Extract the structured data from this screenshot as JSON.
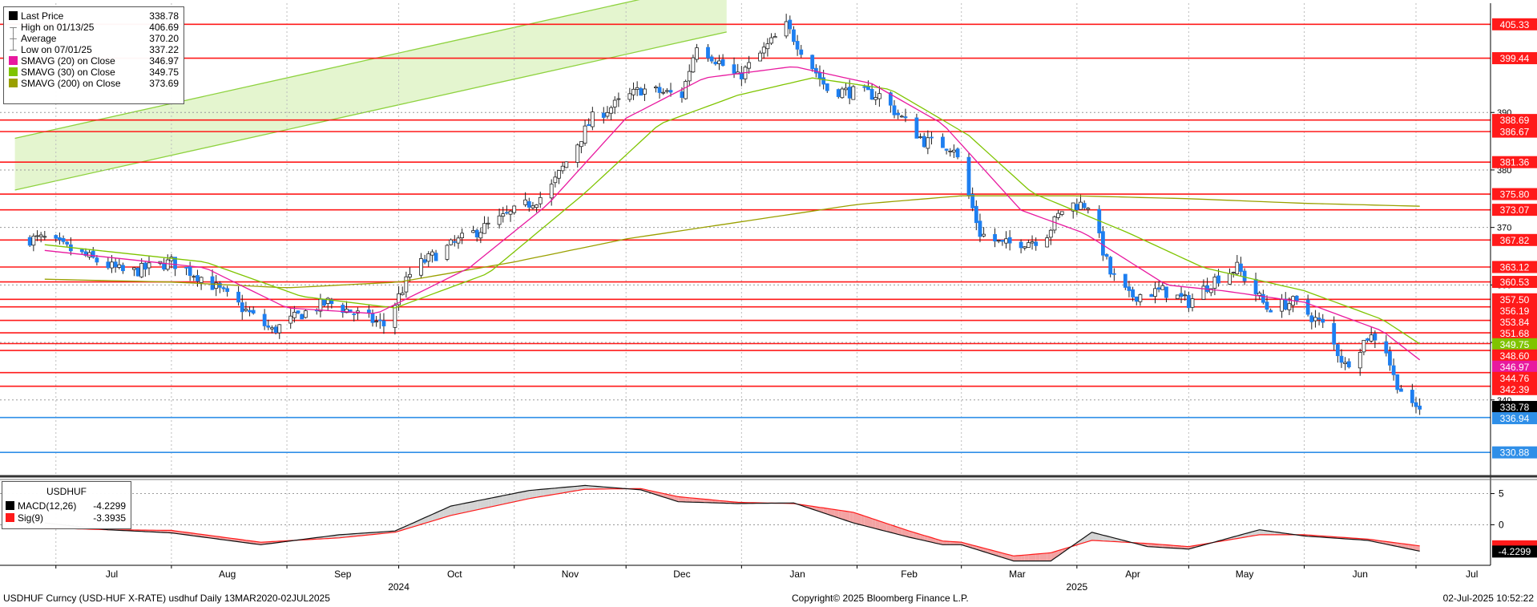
{
  "legend": {
    "items": [
      {
        "label": "Last Price",
        "value": "338.78",
        "color": "#000000",
        "kind": "box"
      },
      {
        "label": "High on 01/13/25",
        "value": "406.69",
        "kind": "tree"
      },
      {
        "label": "Average",
        "value": "370.20",
        "kind": "tree"
      },
      {
        "label": "Low on 07/01/25",
        "value": "337.22",
        "kind": "tree"
      },
      {
        "label": "SMAVG (20)  on Close",
        "value": "346.97",
        "color": "#e8199f",
        "kind": "box"
      },
      {
        "label": "SMAVG (30)  on Close",
        "value": "349.75",
        "color": "#7fc400",
        "kind": "box"
      },
      {
        "label": "SMAVG (200)  on Close",
        "value": "373.69",
        "color": "#9aa000",
        "kind": "box"
      }
    ]
  },
  "macd_legend": {
    "title": "USDHUF",
    "items": [
      {
        "label": "MACD(12,26)",
        "value": "-4.2299",
        "color": "#000000"
      },
      {
        "label": "Sig(9)",
        "value": "-3.3935",
        "color": "#ff1a1a"
      }
    ]
  },
  "footer": {
    "left": "USDHUF Curncy (USD-HUF X-RATE) usdhuf  Daily 13MAR2020-02JUL2025",
    "center": "Copyright© 2025 Bloomberg Finance L.P.",
    "right": "02-Jul-2025 10:52:22"
  },
  "chart_data": {
    "type": "candlestick",
    "title": "",
    "xlabel": "",
    "ylabel": "",
    "ylim": [
      327,
      409
    ],
    "grid": true,
    "legend_position": "top-left",
    "x_months": [
      "Jul",
      "Aug",
      "Sep",
      "Oct",
      "Nov",
      "Dec",
      "Jan",
      "Feb",
      "Mar",
      "Apr",
      "May",
      "Jun",
      "Jul"
    ],
    "x_years": [
      "2024",
      "2025"
    ],
    "y_ticks": [
      340,
      350,
      360,
      370,
      380,
      390
    ],
    "price_key": [
      {
        "x": "2024-06-28",
        "y": 368
      },
      {
        "x": "2024-07-20",
        "y": 362
      },
      {
        "x": "2024-08-01",
        "y": 364
      },
      {
        "x": "2024-08-10",
        "y": 361
      },
      {
        "x": "2024-08-28",
        "y": 352
      },
      {
        "x": "2024-09-05",
        "y": 355
      },
      {
        "x": "2024-09-12",
        "y": 357
      },
      {
        "x": "2024-09-27",
        "y": 353
      },
      {
        "x": "2024-10-05",
        "y": 363
      },
      {
        "x": "2024-10-18",
        "y": 368
      },
      {
        "x": "2024-10-30",
        "y": 372
      },
      {
        "x": "2024-11-10",
        "y": 376
      },
      {
        "x": "2024-11-22",
        "y": 389
      },
      {
        "x": "2024-12-05",
        "y": 394
      },
      {
        "x": "2024-12-16",
        "y": 393
      },
      {
        "x": "2024-12-20",
        "y": 402
      },
      {
        "x": "2024-12-31",
        "y": 396
      },
      {
        "x": "2025-01-13",
        "y": 405
      },
      {
        "x": "2025-01-24",
        "y": 394
      },
      {
        "x": "2025-02-07",
        "y": 393
      },
      {
        "x": "2025-02-19",
        "y": 385
      },
      {
        "x": "2025-02-27",
        "y": 384
      },
      {
        "x": "2025-03-06",
        "y": 369
      },
      {
        "x": "2025-03-12",
        "y": 367
      },
      {
        "x": "2025-03-23",
        "y": 368
      },
      {
        "x": "2025-03-29",
        "y": 374
      },
      {
        "x": "2025-04-04",
        "y": 374
      },
      {
        "x": "2025-04-10",
        "y": 362
      },
      {
        "x": "2025-04-15",
        "y": 358
      },
      {
        "x": "2025-04-24",
        "y": 359
      },
      {
        "x": "2025-05-01",
        "y": 357
      },
      {
        "x": "2025-05-08",
        "y": 361
      },
      {
        "x": "2025-05-14",
        "y": 363
      },
      {
        "x": "2025-05-22",
        "y": 356
      },
      {
        "x": "2025-05-29",
        "y": 357
      },
      {
        "x": "2025-06-06",
        "y": 353
      },
      {
        "x": "2025-06-12",
        "y": 346
      },
      {
        "x": "2025-06-18",
        "y": 351
      },
      {
        "x": "2025-06-22",
        "y": 351
      },
      {
        "x": "2025-06-25",
        "y": 344
      },
      {
        "x": "2025-06-30",
        "y": 338.5
      },
      {
        "x": "2025-07-02",
        "y": 338.78
      }
    ],
    "sma20": [
      {
        "x": "2024-06-28",
        "y": 366
      },
      {
        "x": "2024-08-10",
        "y": 363
      },
      {
        "x": "2024-09-01",
        "y": 356
      },
      {
        "x": "2024-09-25",
        "y": 355
      },
      {
        "x": "2024-10-20",
        "y": 363
      },
      {
        "x": "2024-11-10",
        "y": 374
      },
      {
        "x": "2024-12-01",
        "y": 389
      },
      {
        "x": "2024-12-22",
        "y": 396
      },
      {
        "x": "2025-01-15",
        "y": 398
      },
      {
        "x": "2025-02-05",
        "y": 395
      },
      {
        "x": "2025-02-24",
        "y": 388
      },
      {
        "x": "2025-03-17",
        "y": 373
      },
      {
        "x": "2025-04-03",
        "y": 369
      },
      {
        "x": "2025-04-25",
        "y": 360
      },
      {
        "x": "2025-05-10",
        "y": 359
      },
      {
        "x": "2025-06-01",
        "y": 357
      },
      {
        "x": "2025-06-22",
        "y": 352
      },
      {
        "x": "2025-07-02",
        "y": 346.97
      }
    ],
    "sma30": [
      {
        "x": "2024-06-28",
        "y": 367
      },
      {
        "x": "2024-08-10",
        "y": 364
      },
      {
        "x": "2024-09-05",
        "y": 358
      },
      {
        "x": "2024-09-30",
        "y": 356
      },
      {
        "x": "2024-10-25",
        "y": 362
      },
      {
        "x": "2024-11-20",
        "y": 376
      },
      {
        "x": "2024-12-10",
        "y": 388
      },
      {
        "x": "2024-12-31",
        "y": 393
      },
      {
        "x": "2025-01-20",
        "y": 396
      },
      {
        "x": "2025-02-10",
        "y": 394
      },
      {
        "x": "2025-03-03",
        "y": 386
      },
      {
        "x": "2025-03-20",
        "y": 376
      },
      {
        "x": "2025-04-15",
        "y": 369
      },
      {
        "x": "2025-05-05",
        "y": 363
      },
      {
        "x": "2025-06-01",
        "y": 359
      },
      {
        "x": "2025-06-22",
        "y": 354
      },
      {
        "x": "2025-07-02",
        "y": 349.75
      }
    ],
    "sma200": [
      {
        "x": "2024-06-28",
        "y": 361
      },
      {
        "x": "2024-08-01",
        "y": 360.5
      },
      {
        "x": "2024-09-01",
        "y": 359.5
      },
      {
        "x": "2024-10-01",
        "y": 360.5
      },
      {
        "x": "2024-11-01",
        "y": 364
      },
      {
        "x": "2024-12-01",
        "y": 368
      },
      {
        "x": "2025-01-01",
        "y": 371
      },
      {
        "x": "2025-02-01",
        "y": 374
      },
      {
        "x": "2025-03-01",
        "y": 375.5
      },
      {
        "x": "2025-04-01",
        "y": 375.5
      },
      {
        "x": "2025-05-01",
        "y": 375
      },
      {
        "x": "2025-06-01",
        "y": 374.2
      },
      {
        "x": "2025-07-02",
        "y": 373.69
      }
    ],
    "channel": {
      "lower": [
        {
          "x": "2024-06-20",
          "y": 376.5
        },
        {
          "x": "2024-12-28",
          "y": 404
        }
      ],
      "upper": [
        {
          "x": "2024-06-20",
          "y": 385.5
        },
        {
          "x": "2024-12-28",
          "y": 413
        }
      ]
    },
    "hlines_red": [
      405.33,
      399.44,
      388.69,
      386.67,
      381.36,
      375.8,
      373.07,
      367.82,
      363.12,
      360.53,
      357.5,
      356.19,
      353.84,
      351.68,
      349.8,
      348.6,
      344.76,
      342.39
    ],
    "hlines_blue": [
      336.94,
      330.88
    ],
    "right_labels": [
      {
        "value": "405.33",
        "color": "#ff1a1a",
        "text_color": "#ffffff"
      },
      {
        "value": "399.44",
        "color": "#ff1a1a",
        "text_color": "#ffffff"
      },
      {
        "value": "388.69",
        "color": "#ff1a1a",
        "text_color": "#ffffff"
      },
      {
        "value": "386.67",
        "color": "#ff1a1a",
        "text_color": "#ffffff"
      },
      {
        "value": "381.36",
        "color": "#ff1a1a",
        "text_color": "#ffffff"
      },
      {
        "value": "375.80",
        "color": "#ff1a1a",
        "text_color": "#ffffff"
      },
      {
        "value": "373.07",
        "color": "#ff1a1a",
        "text_color": "#ffffff"
      },
      {
        "value": "367.82",
        "color": "#ff1a1a",
        "text_color": "#ffffff"
      },
      {
        "value": "363.12",
        "color": "#ff1a1a",
        "text_color": "#ffffff"
      },
      {
        "value": "360.53",
        "color": "#ff1a1a",
        "text_color": "#ffffff"
      },
      {
        "value": "357.50",
        "color": "#ff1a1a",
        "text_color": "#ffffff"
      },
      {
        "value": "356.19",
        "color": "#ff1a1a",
        "text_color": "#ffffff"
      },
      {
        "value": "353.84",
        "color": "#ff1a1a",
        "text_color": "#ffffff"
      },
      {
        "value": "351.68",
        "color": "#ff1a1a",
        "text_color": "#ffffff"
      },
      {
        "value": "349.75",
        "color": "#7fc400",
        "text_color": "#ffffff"
      },
      {
        "value": "348.60",
        "color": "#ff1a1a",
        "text_color": "#ffffff"
      },
      {
        "value": "346.97",
        "color": "#e8199f",
        "text_color": "#ffffff"
      },
      {
        "value": "344.76",
        "color": "#ff1a1a",
        "text_color": "#ffffff"
      },
      {
        "value": "342.39",
        "color": "#ff1a1a",
        "text_color": "#ffffff"
      },
      {
        "value": "338.78",
        "color": "#000000",
        "text_color": "#ffffff"
      },
      {
        "value": "336.94",
        "color": "#2f8fe8",
        "text_color": "#ffffff"
      },
      {
        "value": "330.88",
        "color": "#2f8fe8",
        "text_color": "#ffffff"
      }
    ],
    "macd": {
      "ylim": [
        -6.5,
        7
      ],
      "y_ticks": [
        5,
        0
      ],
      "macd_key": [
        {
          "x": "2024-06-28",
          "y": 0.3
        },
        {
          "x": "2024-07-15",
          "y": -0.8
        },
        {
          "x": "2024-08-01",
          "y": -1.3
        },
        {
          "x": "2024-08-25",
          "y": -3.2
        },
        {
          "x": "2024-09-15",
          "y": -1.6
        },
        {
          "x": "2024-09-30",
          "y": -1.0
        },
        {
          "x": "2024-10-15",
          "y": 3.0
        },
        {
          "x": "2024-11-05",
          "y": 5.5
        },
        {
          "x": "2024-11-20",
          "y": 6.3
        },
        {
          "x": "2024-12-05",
          "y": 5.6
        },
        {
          "x": "2024-12-15",
          "y": 3.7
        },
        {
          "x": "2024-12-31",
          "y": 3.4
        },
        {
          "x": "2025-01-15",
          "y": 3.5
        },
        {
          "x": "2025-01-31",
          "y": 0.3
        },
        {
          "x": "2025-02-15",
          "y": -2.0
        },
        {
          "x": "2025-02-24",
          "y": -3.2
        },
        {
          "x": "2025-03-01",
          "y": -3.2
        },
        {
          "x": "2025-03-15",
          "y": -5.8
        },
        {
          "x": "2025-03-25",
          "y": -5.8
        },
        {
          "x": "2025-04-05",
          "y": -1.2
        },
        {
          "x": "2025-04-20",
          "y": -3.5
        },
        {
          "x": "2025-05-01",
          "y": -3.9
        },
        {
          "x": "2025-05-20",
          "y": -0.8
        },
        {
          "x": "2025-06-01",
          "y": -1.8
        },
        {
          "x": "2025-06-18",
          "y": -2.5
        },
        {
          "x": "2025-07-02",
          "y": -4.2299
        }
      ],
      "signal_key": [
        {
          "x": "2024-06-28",
          "y": -0.5
        },
        {
          "x": "2024-07-15",
          "y": -0.8
        },
        {
          "x": "2024-08-01",
          "y": -0.9
        },
        {
          "x": "2024-08-25",
          "y": -2.8
        },
        {
          "x": "2024-09-15",
          "y": -2.1
        },
        {
          "x": "2024-09-30",
          "y": -1.2
        },
        {
          "x": "2024-10-15",
          "y": 1.5
        },
        {
          "x": "2024-11-05",
          "y": 4.2
        },
        {
          "x": "2024-11-20",
          "y": 5.7
        },
        {
          "x": "2024-12-05",
          "y": 5.8
        },
        {
          "x": "2024-12-15",
          "y": 4.5
        },
        {
          "x": "2024-12-31",
          "y": 3.6
        },
        {
          "x": "2025-01-15",
          "y": 3.4
        },
        {
          "x": "2025-01-31",
          "y": 2.0
        },
        {
          "x": "2025-02-15",
          "y": -1.0
        },
        {
          "x": "2025-02-24",
          "y": -2.6
        },
        {
          "x": "2025-03-01",
          "y": -2.8
        },
        {
          "x": "2025-03-15",
          "y": -5.0
        },
        {
          "x": "2025-03-25",
          "y": -4.5
        },
        {
          "x": "2025-04-05",
          "y": -2.5
        },
        {
          "x": "2025-04-20",
          "y": -3.0
        },
        {
          "x": "2025-05-01",
          "y": -3.5
        },
        {
          "x": "2025-05-20",
          "y": -1.6
        },
        {
          "x": "2025-06-01",
          "y": -1.6
        },
        {
          "x": "2025-06-18",
          "y": -2.3
        },
        {
          "x": "2025-07-02",
          "y": -3.3935
        }
      ]
    }
  }
}
